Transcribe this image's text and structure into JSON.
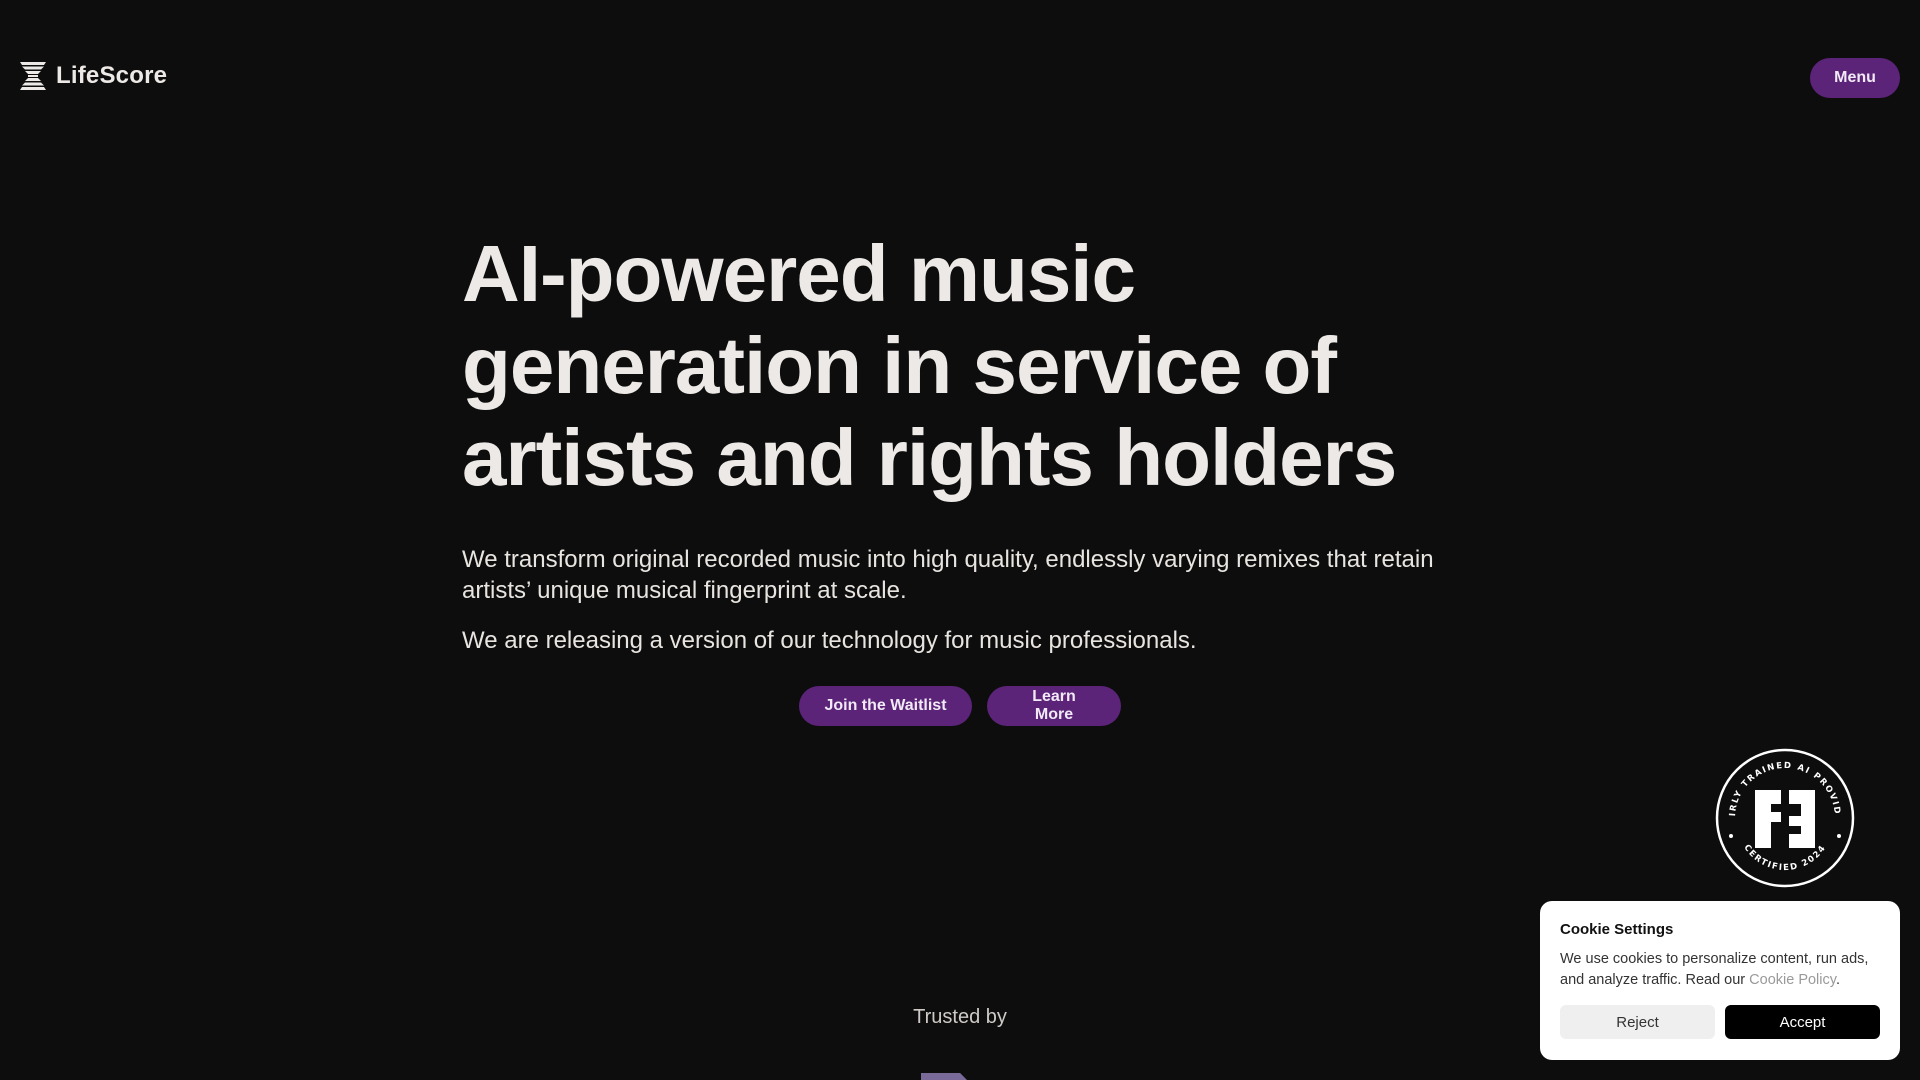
{
  "header": {
    "brand": "LifeScore",
    "logo_icon": "lifescore-logo-icon",
    "menu_label": "Menu"
  },
  "hero": {
    "title": "AI-powered music generation in service of artists and rights holders",
    "subtitle": "We transform original recorded music into high quality, endlessly varying remixes that retain artists’ unique musical fingerprint at scale.",
    "note": "We are releasing a version of our technology for music professionals.",
    "cta_waitlist": "Join the Waitlist",
    "cta_learn_more": "Learn More"
  },
  "badge": {
    "ring_text": "FAIRLY TRAINED AI PROVIDER • CERTIFIED 2024 •",
    "top_text": "FAIRLY TRAINED AI PROVIDER",
    "bottom_text": "CERTIFIED 2024",
    "icon": "fairly-trained-logo-icon"
  },
  "trusted": {
    "label": "Trusted by"
  },
  "cookie": {
    "title": "Cookie Settings",
    "text": "We use cookies to personalize content, run ads, and analyze traffic. Read our ",
    "link_text": "Cookie Policy",
    "text_end": ".",
    "reject_label": "Reject",
    "accept_label": "Accept"
  },
  "colors": {
    "background": "#0e0d0e",
    "accent_purple": "#5b2479",
    "text_light": "#ece9e6"
  }
}
